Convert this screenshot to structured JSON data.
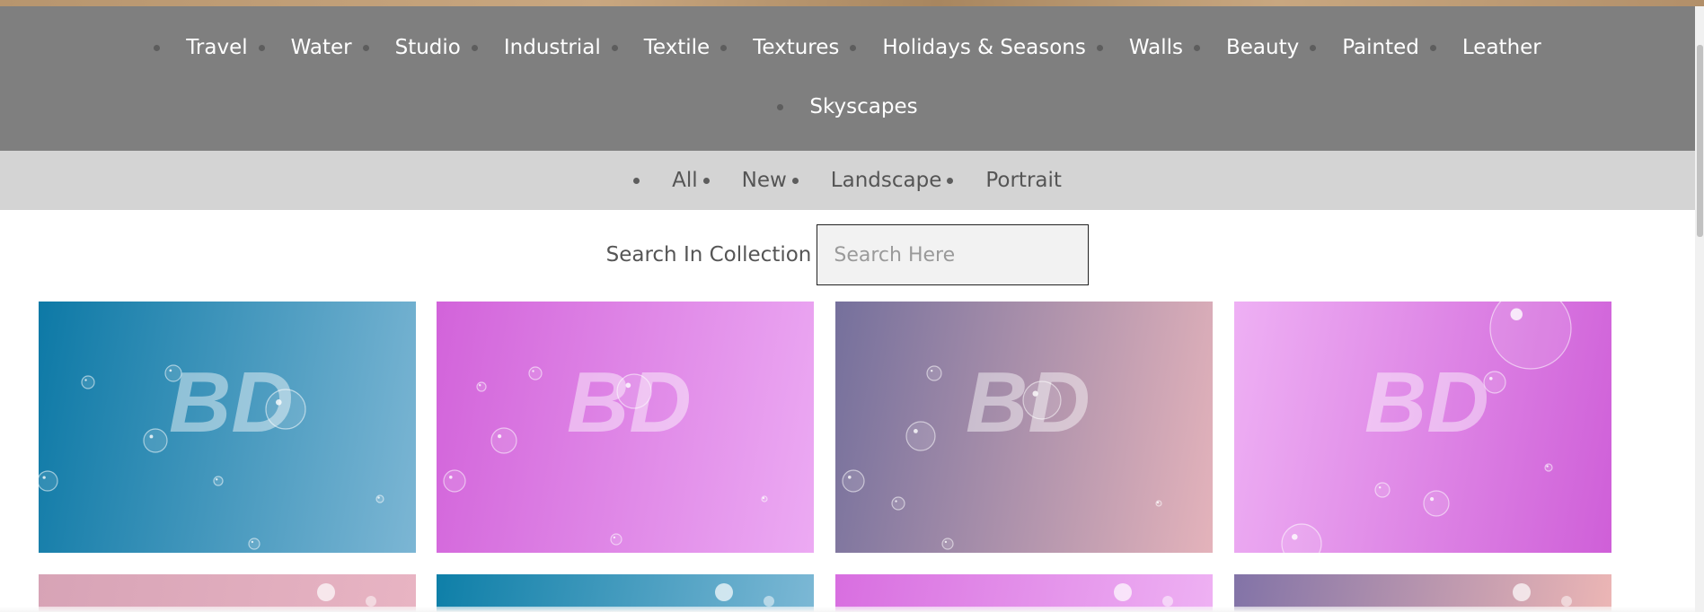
{
  "categories": {
    "row1": [
      "Travel",
      "Water",
      "Studio",
      "Industrial",
      "Textile",
      "Textures",
      "Holidays & Seasons",
      "Walls",
      "Beauty",
      "Painted",
      "Leather"
    ],
    "row2": [
      "Skyscapes"
    ]
  },
  "filters": [
    "All",
    "New",
    "Landscape",
    "Portrait"
  ],
  "search": {
    "label": "Search In Collection",
    "placeholder": "Search Here",
    "value": ""
  },
  "watermark": "BD",
  "colors": {
    "nav_bg": "#7f7f7f",
    "filter_bg": "#d4d4d4"
  },
  "gallery": [
    {
      "theme": "blue-fade",
      "color_a": "#0d79a6",
      "color_b": "#7cb6d4"
    },
    {
      "theme": "magenta-fade",
      "color_a": "#d263da",
      "color_b": "#ecaaf3"
    },
    {
      "theme": "slate-rose-fade",
      "color_a": "#75709c",
      "color_b": "#e4b3bb"
    },
    {
      "theme": "pink-magenta-fade",
      "color_a": "#eeb0f4",
      "color_b": "#cf5fd8"
    },
    {
      "theme": "rose-fade",
      "color_a": "#d7a3b6",
      "color_b": "#e8b4c3"
    },
    {
      "theme": "blue-fade",
      "color_a": "#0e7fa8",
      "color_b": "#7cb8d5"
    },
    {
      "theme": "magenta-fade",
      "color_a": "#d86ee0",
      "color_b": "#eeb1f3"
    },
    {
      "theme": "slate-rose-fade",
      "color_a": "#8273a7",
      "color_b": "#ecb6b5"
    }
  ]
}
